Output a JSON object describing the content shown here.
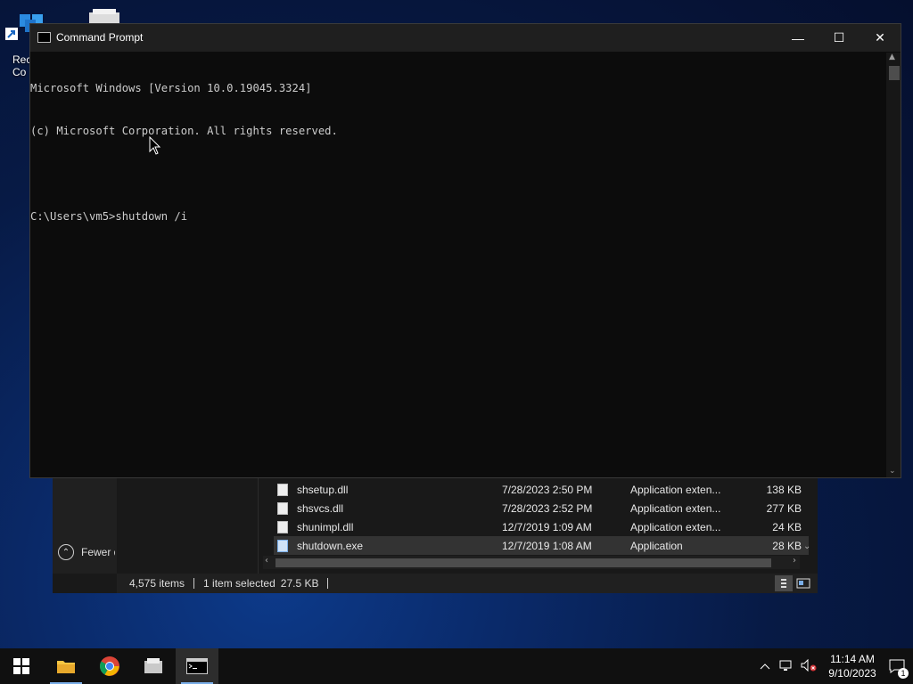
{
  "desktop": {
    "label1": "Rec",
    "label2": "Co"
  },
  "cmd": {
    "title": "Command Prompt",
    "lines": [
      "Microsoft Windows [Version 10.0.19045.3324]",
      "(c) Microsoft Corporation. All rights reserved.",
      "",
      "C:\\Users\\vm5>shutdown /i"
    ],
    "controls": {
      "minimize": "—",
      "maximize": "☐",
      "close": "✕"
    }
  },
  "explorer": {
    "fewer_details": "Fewer details",
    "files": [
      {
        "name": "shsetup.dll",
        "date": "7/28/2023 2:50 PM",
        "type": "Application exten...",
        "size": "138 KB"
      },
      {
        "name": "shsvcs.dll",
        "date": "7/28/2023 2:52 PM",
        "type": "Application exten...",
        "size": "277 KB"
      },
      {
        "name": "shunimpl.dll",
        "date": "12/7/2019 1:09 AM",
        "type": "Application exten...",
        "size": "24 KB"
      },
      {
        "name": "shutdown.exe",
        "date": "12/7/2019 1:08 AM",
        "type": "Application",
        "size": "28 KB"
      }
    ],
    "status": {
      "items": "4,575 items",
      "selected": "1 item selected",
      "size": "27.5 KB"
    }
  },
  "taskbar": {
    "time": "11:14 AM",
    "date": "9/10/2023",
    "notification_count": "1"
  },
  "colors": {
    "console_bg": "#0c0c0c",
    "console_text": "#cccccc",
    "taskbar_bg": "#101010",
    "accent": "#7aaee8"
  }
}
